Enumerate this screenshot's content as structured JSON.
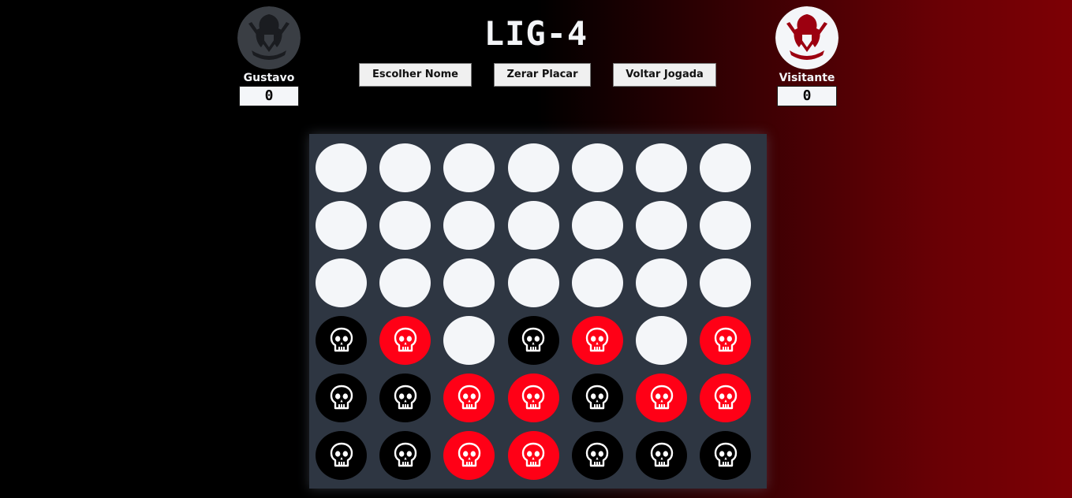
{
  "title": "LIG-4",
  "toolbar": {
    "choose_name_label": "Escolher Nome",
    "reset_score_label": "Zerar Placar",
    "undo_label": "Voltar Jogada"
  },
  "players": [
    {
      "name": "Gustavo",
      "score": "0",
      "color": "#000000",
      "avatar_icon": "spartan-helmet-icon"
    },
    {
      "name": "Visitante",
      "score": "0",
      "color": "#ff0016",
      "avatar_icon": "spartan-helmet-icon"
    }
  ],
  "board": {
    "columns": 7,
    "rows": 6,
    "piece_icon": "skull-icon",
    "colors": {
      "empty": "#f4f6f9",
      "black": "#000000",
      "red": "#ff0016",
      "board": "#2e3642"
    },
    "cells": [
      [
        "empty",
        "empty",
        "empty",
        "empty",
        "empty",
        "empty",
        "empty"
      ],
      [
        "empty",
        "empty",
        "empty",
        "empty",
        "empty",
        "empty",
        "empty"
      ],
      [
        "empty",
        "empty",
        "empty",
        "empty",
        "empty",
        "empty",
        "empty"
      ],
      [
        "black",
        "red",
        "empty",
        "black",
        "red",
        "empty",
        "red"
      ],
      [
        "black",
        "black",
        "red",
        "red",
        "black",
        "red",
        "red"
      ],
      [
        "black",
        "black",
        "red",
        "red",
        "black",
        "black",
        "black"
      ]
    ]
  }
}
